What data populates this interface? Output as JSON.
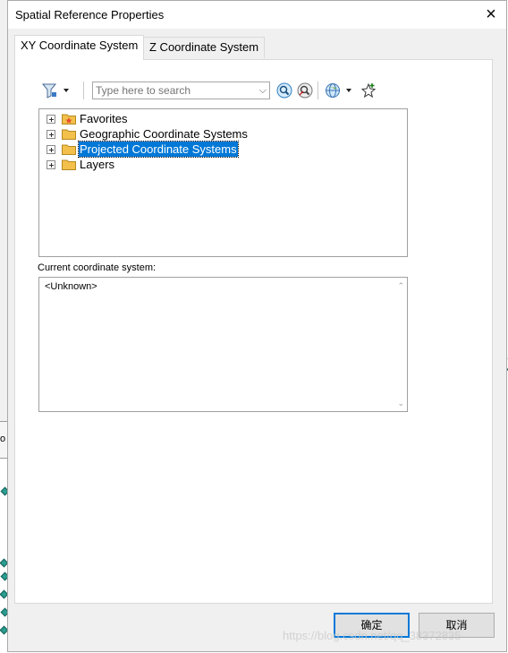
{
  "window": {
    "title": "Spatial Reference Properties",
    "close_glyph": "×"
  },
  "tabs": [
    {
      "label": "XY Coordinate System",
      "active": true
    },
    {
      "label": "Z Coordinate System",
      "active": false
    }
  ],
  "toolbar": {
    "filter_icon": "filter-icon",
    "search_placeholder": "Type here to search",
    "search_value": "",
    "search_go_icon": "search-icon",
    "clear_search_icon": "clear-search-icon",
    "globe_icon": "globe-icon",
    "add_favorite_icon": "add-favorite-icon"
  },
  "tree": {
    "items": [
      {
        "label": "Favorites",
        "icon": "favorites-folder-icon",
        "selected": false
      },
      {
        "label": "Geographic Coordinate Systems",
        "icon": "folder-icon",
        "selected": false
      },
      {
        "label": "Projected Coordinate Systems",
        "icon": "folder-icon",
        "selected": true
      },
      {
        "label": "Layers",
        "icon": "folder-icon",
        "selected": false
      }
    ]
  },
  "current": {
    "label": "Current coordinate system:",
    "value": "<Unknown>"
  },
  "buttons": {
    "ok": "确定",
    "cancel": "取消"
  },
  "background": {
    "left_fragment": "o"
  },
  "watermark": "https://blog.csdn.net/qq_38372835",
  "colors": {
    "selection": "#0078d7",
    "folder": "#f2c04b",
    "dialog_bg": "#f0f0f0"
  }
}
